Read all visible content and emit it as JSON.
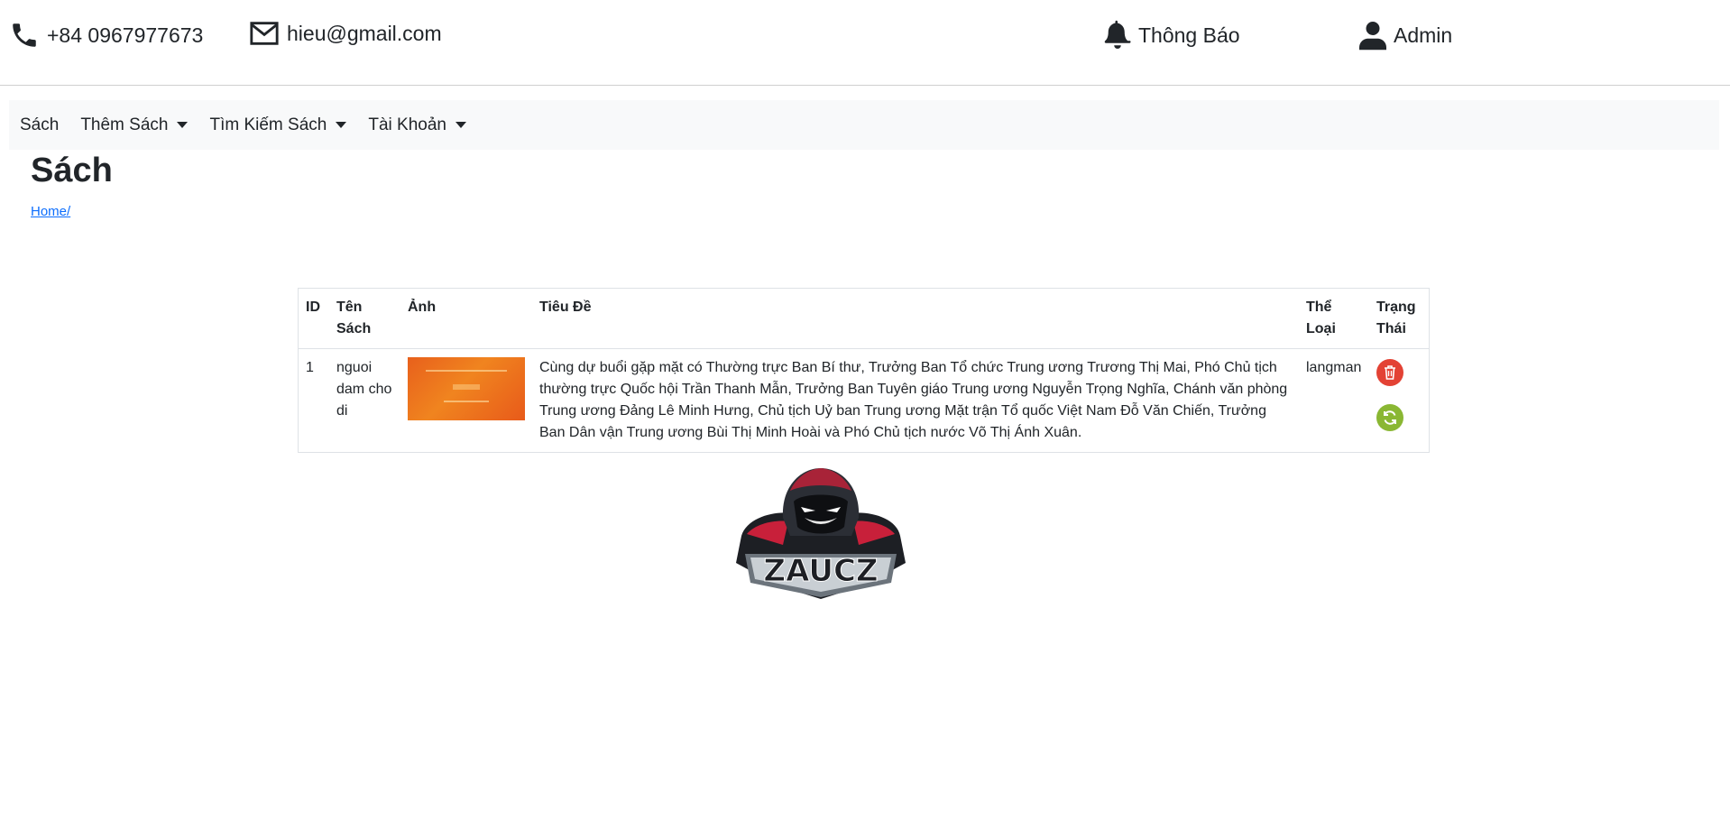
{
  "topbar": {
    "phone": "+84 0967977673",
    "email": "hieu@gmail.com",
    "notifications": "Thông Báo",
    "account": "Admin"
  },
  "navbar": {
    "items": [
      {
        "label": "Sách",
        "dropdown": false
      },
      {
        "label": "Thêm Sách",
        "dropdown": true
      },
      {
        "label": "Tìm Kiếm Sách",
        "dropdown": true
      },
      {
        "label": "Tài Khoản",
        "dropdown": true
      }
    ]
  },
  "page": {
    "title": "Sách",
    "breadcrumb": "Home/"
  },
  "table": {
    "headers": {
      "id": "ID",
      "name": "Tên Sách",
      "image": "Ảnh",
      "title": "Tiêu Đề",
      "category": "Thể Loại",
      "status": "Trạng Thái"
    },
    "rows": [
      {
        "id": "1",
        "name": "nguoi dam cho di",
        "title": "Cùng dự buổi gặp mặt có Thường trực Ban Bí thư, Trưởng Ban Tổ chức Trung ương Trương Thị Mai, Phó Chủ tịch thường trực Quốc hội Trần Thanh Mẫn, Trưởng Ban Tuyên giáo Trung ương Nguyễn Trọng Nghĩa, Chánh văn phòng Trung ương Đảng Lê Minh Hưng, Chủ tịch Uỷ ban Trung ương Mặt trận Tổ quốc Việt Nam Đỗ Văn Chiến, Trưởng Ban Dân vận Trung ương Bùi Thị Minh Hoài và Phó Chủ tịch nước Võ Thị Ánh Xuân.",
        "category": "langman"
      }
    ]
  },
  "logo": {
    "text": "ZAUCZ"
  },
  "colors": {
    "delete": "#e34234",
    "update": "#8ab733",
    "link": "#0d6efd",
    "navbar_bg": "#f8f9fa"
  },
  "icons": [
    "phone-icon",
    "envelope-icon",
    "bell-icon",
    "user-icon",
    "trash-icon",
    "sync-icon"
  ]
}
